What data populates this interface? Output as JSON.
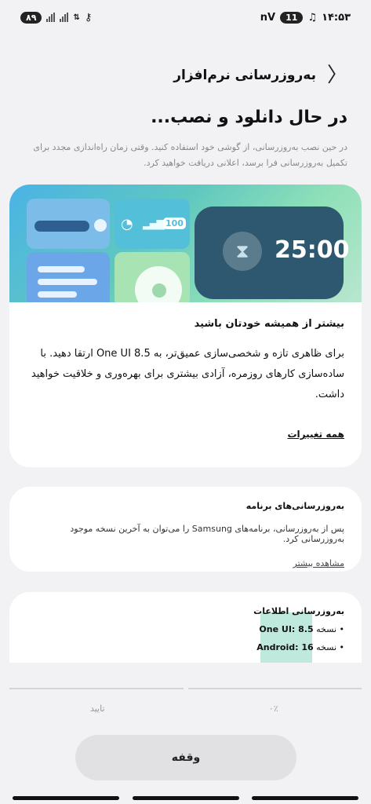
{
  "status_bar": {
    "time": "۱۴:۵۳",
    "badge_right": "11",
    "network": "nV",
    "battery": "۸۹"
  },
  "header": {
    "title": "به‌روزرسانی نرم‌افزار"
  },
  "main": {
    "title": "در حال دانلود و نصب...",
    "description": "در حین نصب به‌روزرسانی، از گوشی خود استفاده کنید. وقتی زمان راه‌اندازی مجدد برای تکمیل به‌روزرسانی فرا برسد، اعلانی دریافت خواهید کرد."
  },
  "feature_card": {
    "timer_text": "25:00",
    "battery_badge": "100",
    "title": "بیشتر از همیشه خودتان باشید",
    "body": "برای ظاهری تازه و شخصی‌سازی عمیق‌تر، به One UI 8.5 ارتقا دهید. با ساده‌سازی کارهای روزمره، آزادی بیشتری برای بهره‌وری و خلاقیت خواهید داشت.",
    "link": "همه تغییرات"
  },
  "apps_card": {
    "title": "به‌روزرسانی‌های برنامه",
    "text": "پس از به‌روزرسانی، برنامه‌های Samsung را می‌توان به آخرین نسخه موجود به‌روزرسانی کرد.",
    "link": "مشاهده بیشتر"
  },
  "info_card": {
    "title": "به‌روزرسانی اطلاعات",
    "items": [
      {
        "label": "• نسخه",
        "value": "One UI: 8.5"
      },
      {
        "label": "• نسخه",
        "value": "Android: 16"
      }
    ]
  },
  "progress": {
    "percent_label": "۰٪",
    "confirm_label": "تایید"
  },
  "footer": {
    "pause_label": "وقفه"
  },
  "colors": {
    "background": "#f2f2f4",
    "card": "#ffffff",
    "button": "#e1e1e3"
  }
}
